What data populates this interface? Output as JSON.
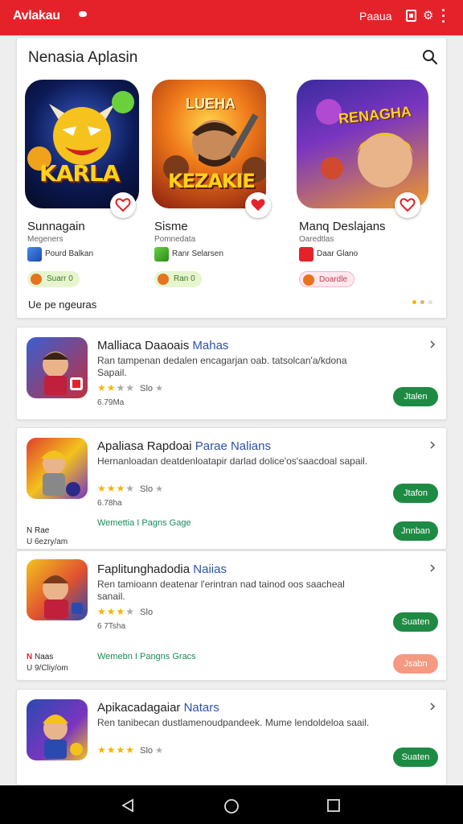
{
  "topbar": {
    "brand": "Avlakau",
    "label": "Paaua",
    "color": "#e5222a"
  },
  "featured": {
    "title": "Nenasia Aplasin",
    "footer": "Ue pe ngeuras",
    "items": [
      {
        "art_text": "KARLA",
        "name": "Sunnagain",
        "subtitle": "Megeners",
        "dev": "Pourd Balkan",
        "badge": "Suarr 0",
        "badge_bg": "#e6f5cf",
        "badge_color": "#3a7a20"
      },
      {
        "art_text_top": "LUEHA",
        "art_text": "KEZAKIE",
        "name": "Sisme",
        "subtitle": "Pomnedata",
        "dev": "Ranr Selarsen",
        "badge": "Ran 0",
        "badge_bg": "#e6f5cf",
        "badge_color": "#3a7a20"
      },
      {
        "art_text": "RENAGHA",
        "name": "Manq Deslajans",
        "subtitle": "Oaredtlas",
        "dev": "Daar Glano",
        "badge": "Doardle",
        "badge_bg": "#fde8ec",
        "badge_color": "#c43c54"
      }
    ]
  },
  "list": [
    {
      "title": "Malliaca Daaoais",
      "tag": "Mahas",
      "desc": "Ran tampenan dedalen encagarjan oab. tatsolcan'a/kdona Sapail.",
      "rating": "Slo",
      "size": "6.79Ma",
      "button": "Jtalen"
    },
    {
      "title": "Apaliasa Rapdoai",
      "tag": "Parae Nalians",
      "desc": "Hernanloadan deatdenloatapir darlad dolice'os'saacdoal sapail.",
      "rating": "Slo",
      "size": "6.78ha",
      "button": "Jtafon",
      "extra_l1_a": "N",
      "extra_l1_b": "Rae",
      "extra_l2": "U 6ezry/am",
      "link": "Wemettia I Pagns Gage",
      "button2": "Jnnban"
    },
    {
      "title": "Faplitunghadodia",
      "tag": "Naiias",
      "desc": "Ren tamioann deatenar l'erintran nad tainod oos saacheal sanail.",
      "rating": "Slo",
      "size": "6 7Tsha",
      "button": "Suaten",
      "extra_l1_a": "N",
      "extra_l1_b": "Naas",
      "extra_l2": "U 9/Cliy/om",
      "link": "Wemebn I Pangns Gracs",
      "button2": "Jsabn"
    },
    {
      "title": "Apikacadagaiar",
      "tag": "Natars",
      "desc": "Ren tanibecan dustlamenoudpandeek. Mume lendoldeloa saail.",
      "rating": "Slo",
      "button": "Suaten"
    }
  ]
}
